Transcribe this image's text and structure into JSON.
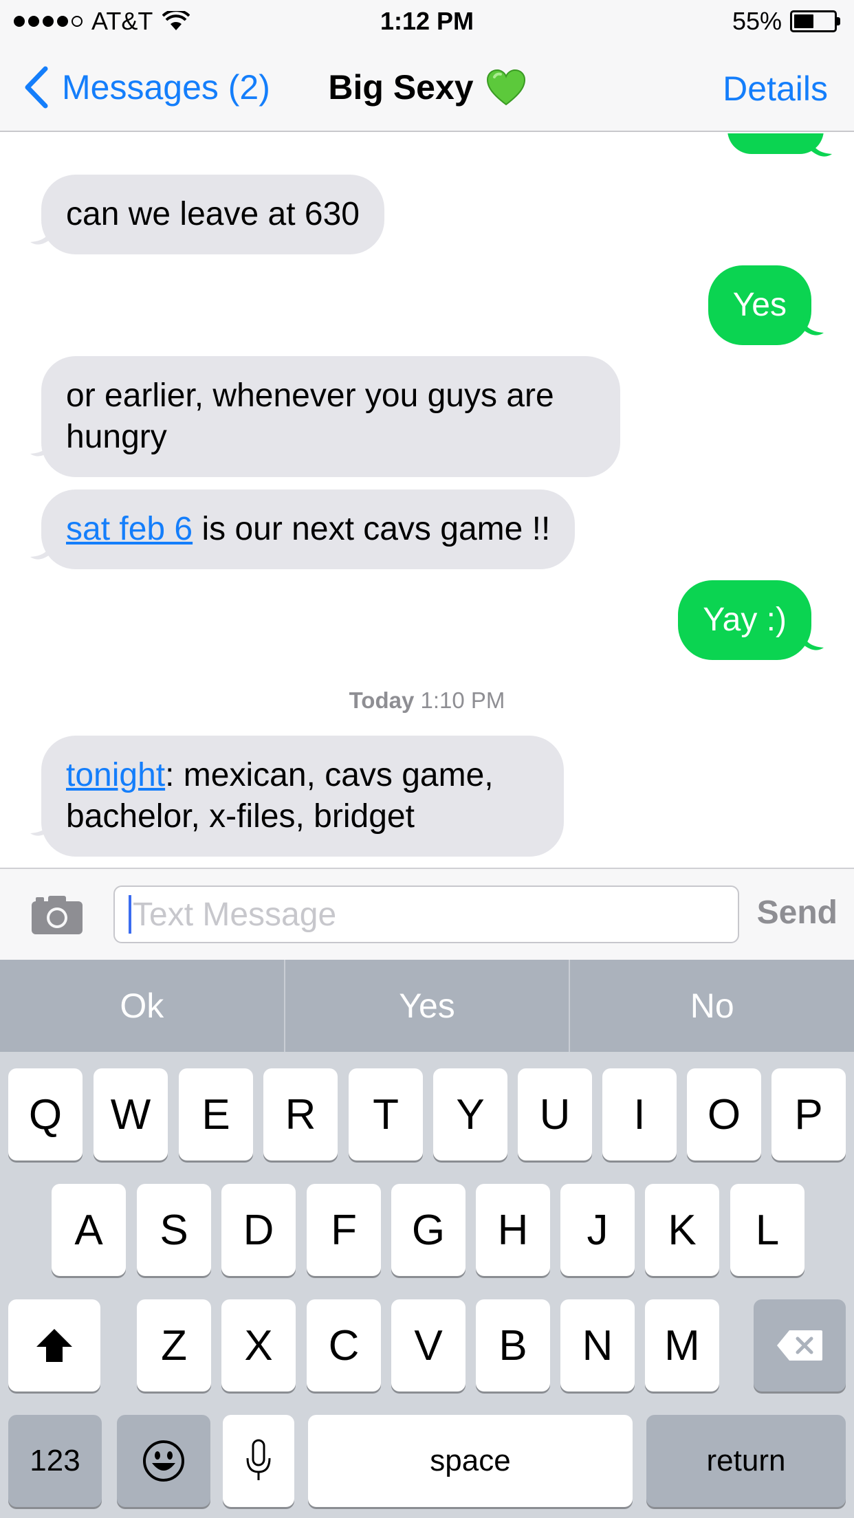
{
  "status_bar": {
    "carrier": "AT&T",
    "time": "1:12 PM",
    "battery_percent": "55%",
    "battery_level": 0.55,
    "signal_bars_filled": 4,
    "signal_bars_total": 5
  },
  "nav": {
    "back_label": "Messages (2)",
    "title": "Big Sexy",
    "details_label": "Details",
    "accent_color": "#147efb"
  },
  "messages": [
    {
      "from": "them",
      "text": "can we leave at 630"
    },
    {
      "from": "me",
      "text": "Yes"
    },
    {
      "from": "them",
      "text_line1": "or earlier, whenever you guys are",
      "text_line2": "hungry"
    },
    {
      "from": "them",
      "link": "sat feb 6",
      "text": " is our next cavs game !!"
    },
    {
      "from": "me",
      "text": "Yay :)"
    },
    {
      "from": "them",
      "link": "tonight",
      "text_line1": ": mexican, cavs game,",
      "text_line2": "bachelor, x-files, bridget"
    }
  ],
  "timestamp": {
    "day": "Today",
    "time": "1:10 PM"
  },
  "composer": {
    "placeholder": "Text Message",
    "send_label": "Send"
  },
  "predictive": [
    "Ok",
    "Yes",
    "No"
  ],
  "keyboard": {
    "row1": [
      "Q",
      "W",
      "E",
      "R",
      "T",
      "Y",
      "U",
      "I",
      "O",
      "P"
    ],
    "row2": [
      "A",
      "S",
      "D",
      "F",
      "G",
      "H",
      "J",
      "K",
      "L"
    ],
    "row3": [
      "Z",
      "X",
      "C",
      "V",
      "B",
      "N",
      "M"
    ],
    "numbers_label": "123",
    "space_label": "space",
    "return_label": "return"
  },
  "colors": {
    "sent_bubble": "#0bd451",
    "received_bubble": "#e5e5ea",
    "link": "#147efb"
  }
}
